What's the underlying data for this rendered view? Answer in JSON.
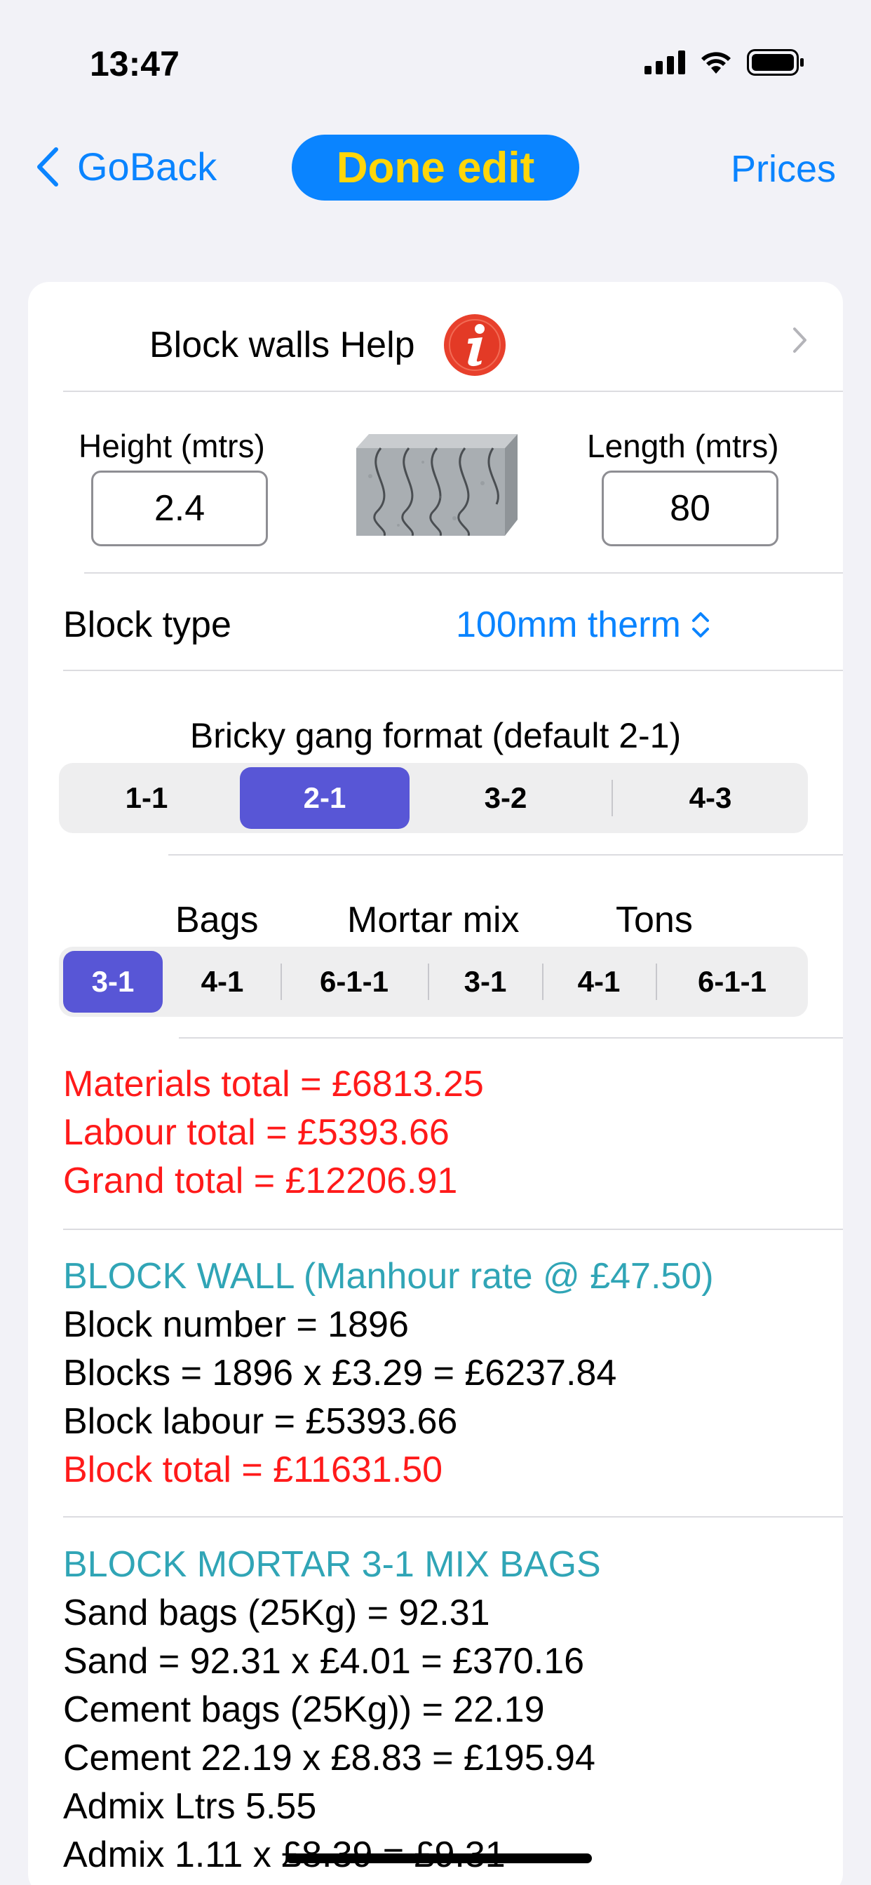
{
  "status": {
    "time": "13:47"
  },
  "nav": {
    "back_label": "GoBack",
    "done_label": "Done edit",
    "prices_label": "Prices",
    "accent": "#0a84ff",
    "done_text_color": "#ffd60a"
  },
  "help": {
    "label": "Block walls Help",
    "icon": "info-icon"
  },
  "dimensions": {
    "height_label": "Height (mtrs)",
    "height_value": "2.4",
    "length_label": "Length (mtrs)",
    "length_value": "80"
  },
  "block_type": {
    "label": "Block type",
    "value": "100mm therm"
  },
  "gang": {
    "title": "Bricky gang format (default 2-1)",
    "options": [
      "1-1",
      "2-1",
      "3-2",
      "4-3"
    ],
    "selected": "2-1"
  },
  "mortar": {
    "head_bags": "Bags",
    "head_mix": "Mortar mix",
    "head_tons": "Tons",
    "options": [
      "3-1",
      "4-1",
      "6-1-1",
      "3-1",
      "4-1",
      "6-1-1"
    ],
    "selected_index": 0
  },
  "totals": {
    "materials": "Materials total = £6813.25",
    "labour": "Labour total = £5393.66",
    "grand": "Grand total = £12206.91"
  },
  "block_wall": {
    "heading": "BLOCK WALL (Manhour rate @ £47.50)",
    "number": "Block number = 1896",
    "blocks": "Blocks = 1896 x £3.29 = £6237.84",
    "labour": "Block labour = £5393.66",
    "total": "Block total = £11631.50"
  },
  "block_mortar": {
    "heading": "BLOCK MORTAR 3-1 MIX BAGS",
    "sand_bags": "Sand bags (25Kg) = 92.31",
    "sand": "Sand = 92.31 x £4.01 = £370.16",
    "cement_bags": "Cement bags (25Kg)) = 22.19",
    "cement": "Cement 22.19 x £8.83 = £195.94",
    "admix_ltrs": "Admix Ltrs 5.55",
    "admix": "Admix 1.11 x £8.39 = £9.31"
  },
  "colors": {
    "selected_segment": "#5856d6",
    "total_red": "#ff1a1a",
    "heading_teal": "#30a5b6"
  }
}
